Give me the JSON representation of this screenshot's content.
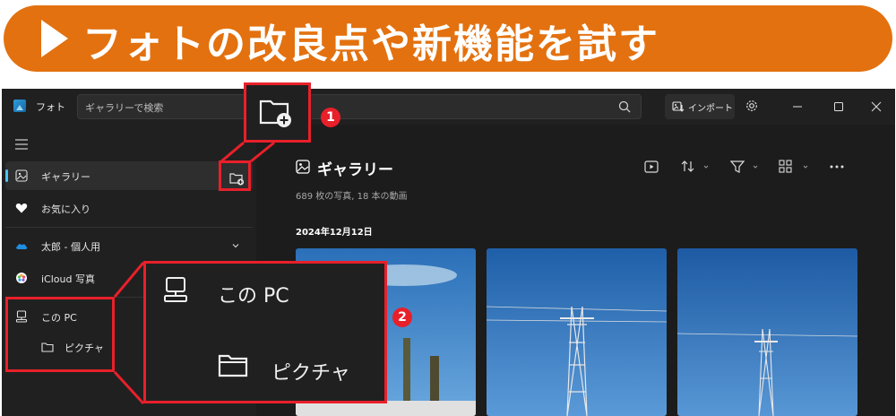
{
  "banner": {
    "title": "フォトの改良点や新機能を試す"
  },
  "titlebar": {
    "app_name": "フォト",
    "search_placeholder": "ギャラリーで検索",
    "import_label": "インポート"
  },
  "sidebar": {
    "items": [
      {
        "label": "ギャラリー",
        "icon": "gallery-icon"
      },
      {
        "label": "お気に入り",
        "icon": "heart-icon"
      },
      {
        "label": "太郎 - 個人用",
        "icon": "onedrive-icon"
      },
      {
        "label": "iCloud 写真",
        "icon": "icloud-photos-icon"
      },
      {
        "label": "この PC",
        "icon": "computer-icon"
      },
      {
        "label": "ピクチャ",
        "icon": "folder-icon"
      }
    ]
  },
  "main": {
    "title": "ギャラリー",
    "subtitle": "689 枚の写真, 18 本の動画",
    "date_group": "2024年12月12日"
  },
  "callouts": {
    "badge1": "1",
    "badge2": "2",
    "zoom_this_pc": "この PC",
    "zoom_pictures": "ピクチャ"
  },
  "colors": {
    "banner": "#e3710f",
    "accent": "#4cc2ff",
    "callout": "#e8202a",
    "background": "#202020"
  }
}
